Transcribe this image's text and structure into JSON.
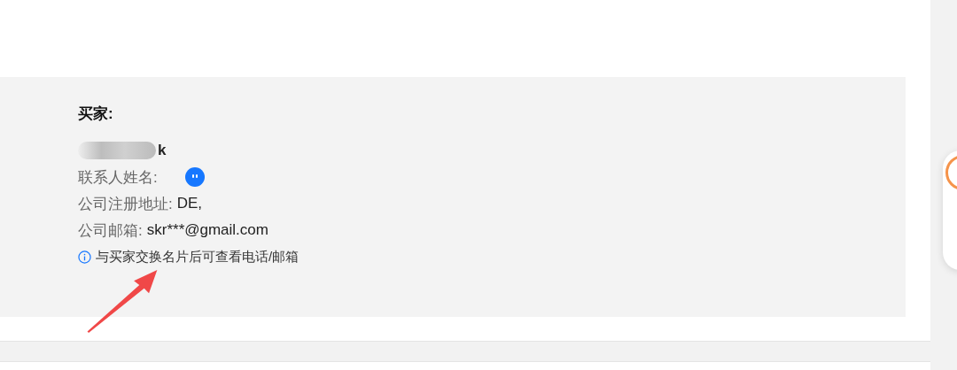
{
  "buyer": {
    "heading": "买家:",
    "name": "k",
    "fields": [
      {
        "label": "联系人姓名:",
        "kind": "avatar"
      },
      {
        "label": "公司注册地址:",
        "value": "DE,",
        "kind": "text"
      },
      {
        "label": "公司邮箱:",
        "value": "skr***@gmail.com",
        "kind": "text"
      }
    ],
    "hint": "与买家交换名片后可查看电话/邮箱"
  }
}
